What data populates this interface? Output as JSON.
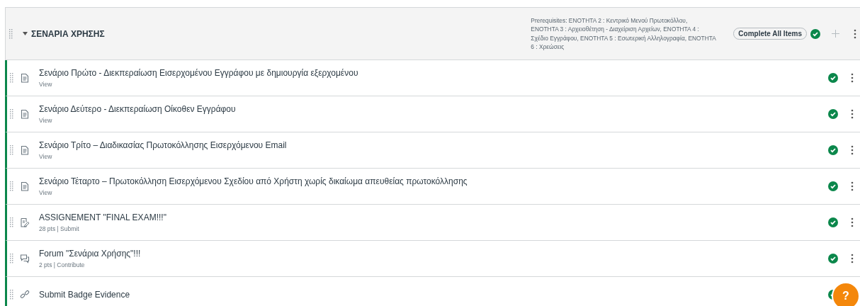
{
  "module": {
    "title": "ΣΕΝΑΡΙΑ ΧΡΗΣΗΣ",
    "expanded": true,
    "prerequisites": "Prerequisites: ΕΝΟΤΗΤΑ 2 : Κεντρικό Μενού Πρωτοκόλλου, ΕΝΟΤΗΤΑ 3 : Αρχειοθέτηση - Διαχείριση Αρχείων, ΕΝΟΤΗΤΑ 4 : Σχέδιο Εγγράφου, ΕΝΟΤΗΤΑ 5 : Εσωτερική Αλληλογραφία, ΕΝΟΤΗΤΑ 6 : Χρεώσεις",
    "requirement": "Complete All Items",
    "completed": true
  },
  "items": [
    {
      "kind": "page",
      "title": "Σενάριο Πρώτο - Διεκπεραίωση Εισερχομένου Εγγράφου με δημιουργία εξερχομένου",
      "meta": "View",
      "completed": true
    },
    {
      "kind": "page",
      "title": "Σενάριο Δεύτερο - Διεκπεραίωση Οίκοθεν Εγγράφου",
      "meta": "View",
      "completed": true
    },
    {
      "kind": "page",
      "title": "Σενάριο Τρίτο – Διαδικασίας Πρωτοκόλλησης Εισερχόμενου Email",
      "meta": "View",
      "completed": true
    },
    {
      "kind": "page",
      "title": "Σενάριο Τέταρτο – Πρωτοκόλληση Εισερχόμενου Σχεδίου από Χρήστη χωρίς δικαίωμα απευθείας πρωτοκόλλησης",
      "meta": "View",
      "completed": true
    },
    {
      "kind": "assignment",
      "title": "ASSIGNEMENT \"FINAL EXAM!!!\"",
      "meta": "28 pts | Submit",
      "completed": true
    },
    {
      "kind": "discussion",
      "title": "Forum \"Σενάρια Χρήσης\"!!!",
      "meta": "2 pts | Contribute",
      "completed": true
    },
    {
      "kind": "link",
      "title": "Submit Badge Evidence",
      "completed": true
    }
  ],
  "help_button": {
    "label": "?"
  }
}
